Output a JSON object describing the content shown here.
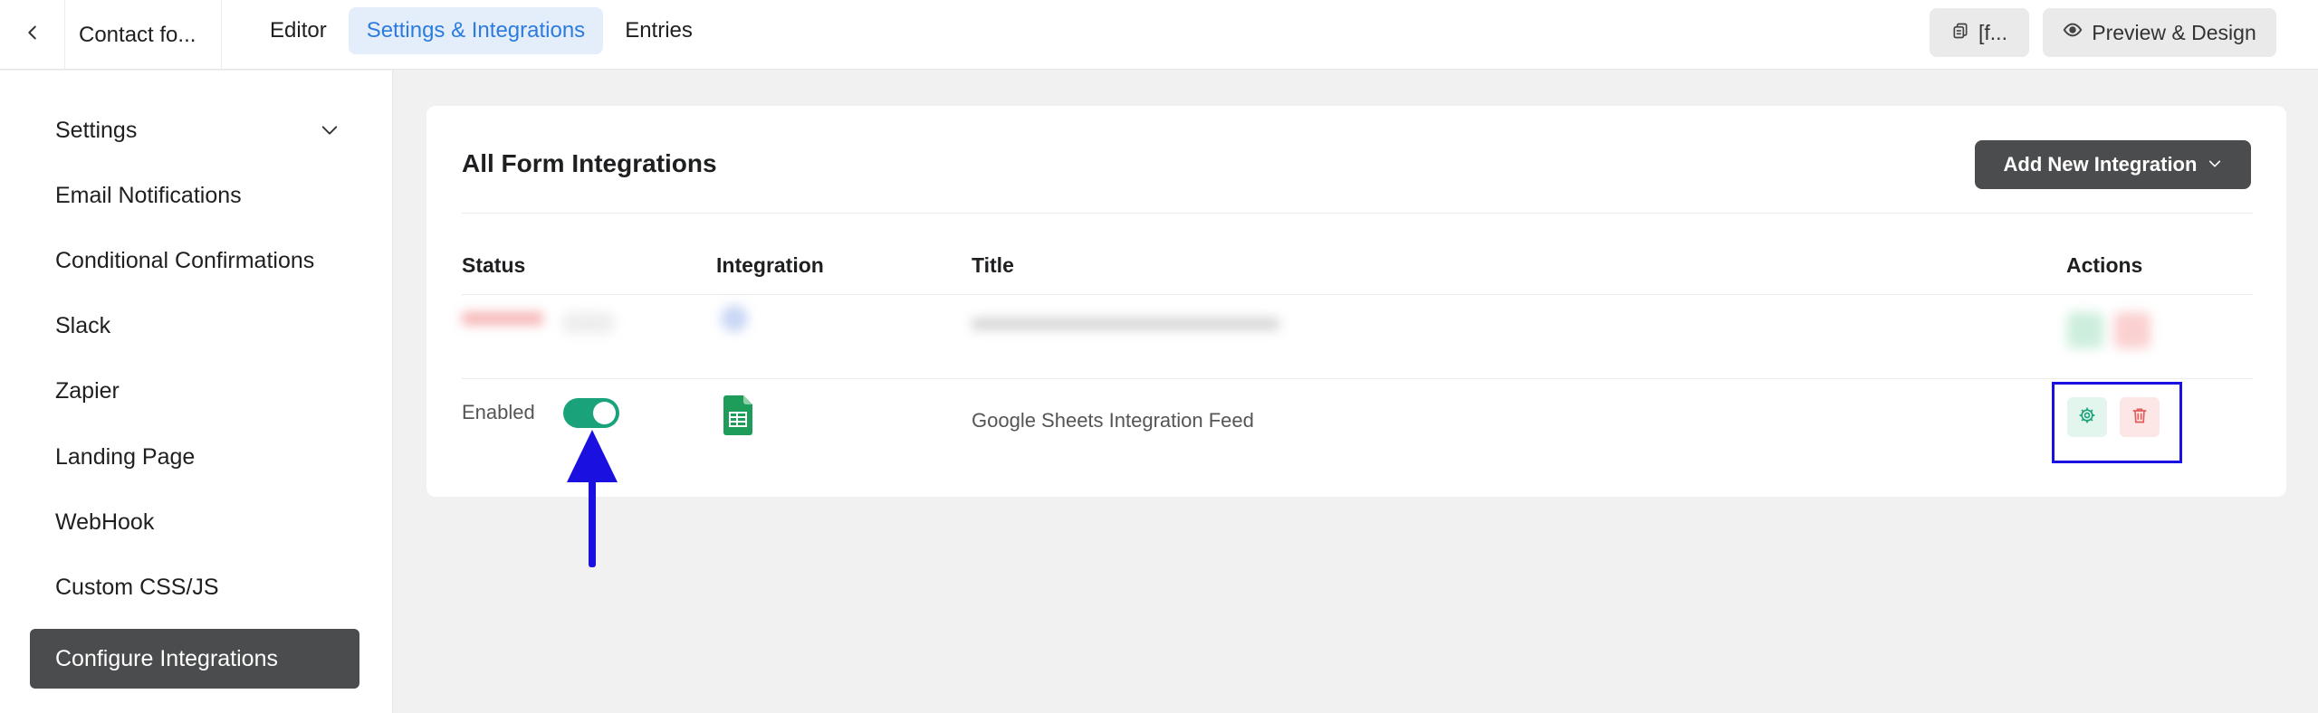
{
  "topbar": {
    "back_icon": "chevron-left-icon",
    "form_title": "Contact fo...",
    "tabs": [
      {
        "label": "Editor"
      },
      {
        "label": "Settings & Integrations"
      },
      {
        "label": "Entries"
      }
    ],
    "shortcode_label": "[f...",
    "preview_label": "Preview & Design"
  },
  "sidebar": {
    "items": [
      {
        "label": "Settings"
      },
      {
        "label": "Email Notifications"
      },
      {
        "label": "Conditional Confirmations"
      },
      {
        "label": "Slack"
      },
      {
        "label": "Zapier"
      },
      {
        "label": "Landing Page"
      },
      {
        "label": "WebHook"
      },
      {
        "label": "Custom CSS/JS"
      },
      {
        "label": "Configure Integrations"
      }
    ]
  },
  "main": {
    "title": "All Form Integrations",
    "add_button_label": "Add New Integration",
    "columns": [
      "Status",
      "Integration",
      "Title",
      "Actions"
    ],
    "rows": [
      {
        "status": "Enabled",
        "enabled": true,
        "integration_icon": "google-sheets-icon",
        "title": "Google Sheets Integration Feed"
      }
    ]
  },
  "colors": {
    "accent": "#2c7bdd",
    "toggle_on": "#1aa27b",
    "annotation": "#1a10e0",
    "dark_button": "#4b4c4d"
  }
}
